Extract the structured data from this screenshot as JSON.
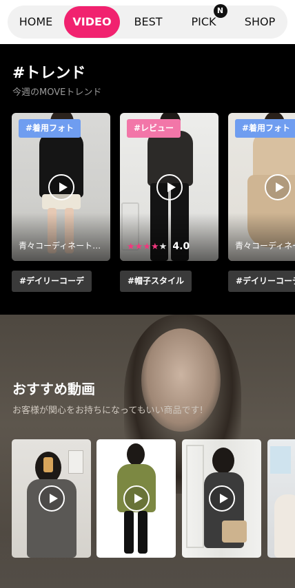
{
  "nav": {
    "items": [
      {
        "label": "HOME"
      },
      {
        "label": "VIDEO"
      },
      {
        "label": "BEST"
      },
      {
        "label": "PICK"
      },
      {
        "label": "SHOP"
      }
    ],
    "active_index": 1,
    "active_color": "#f1226f",
    "pick_badge": "N"
  },
  "trend": {
    "title": "#トレンド",
    "subtitle": "今週のMOVEトレンド",
    "cards": [
      {
        "badge": "#着用フォト",
        "badge_color": "#6f9df0",
        "caption": "青々コーディネート…",
        "tag": "#デイリーコーデ"
      },
      {
        "badge": "#レビュー",
        "badge_color": "#f276a8",
        "rating": "4.0",
        "stars_filled": 4,
        "stars_total": 5,
        "tag": "#帽子スタイル"
      },
      {
        "badge": "#着用フォト",
        "badge_color": "#6f9df0",
        "caption": "青々コーディネー…",
        "tag": "#デイリーコーデ"
      }
    ]
  },
  "recommend": {
    "title": "おすすめ動画",
    "subtitle": "お客様が関心をお持ちになってもいい商品です!",
    "cards": [
      {
        "name": "gray-shirt-mirror"
      },
      {
        "name": "olive-jacket"
      },
      {
        "name": "tweed-vest-bag"
      },
      {
        "name": "partial-card"
      }
    ]
  },
  "icons": {
    "play": "play-icon",
    "star": "star-icon"
  }
}
